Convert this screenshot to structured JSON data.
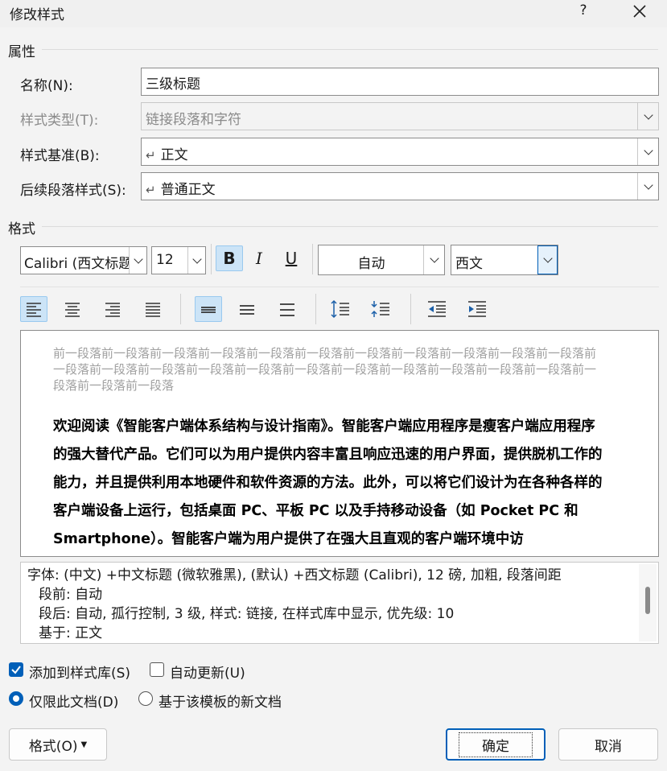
{
  "window": {
    "title": "修改样式",
    "help": "?",
    "close": "✕"
  },
  "properties": {
    "section_label": "属性",
    "name_label": "名称(N):",
    "name_value": "三级标题",
    "type_label": "样式类型(T):",
    "type_value": "链接段落和字符",
    "based_label": "样式基准(B):",
    "based_value": "正文",
    "next_label": "后续段落样式(S):",
    "next_value": "普通正文"
  },
  "format": {
    "section_label": "格式",
    "font": "Calibri (西文标题",
    "size": "12",
    "bold": "B",
    "italic": "I",
    "underline": "U",
    "color": "自动",
    "script": "西文"
  },
  "preview": {
    "previous_paragraph": "前一段落前一段落前一段落前一段落前一段落前一段落前一段落前一段落前一段落前一段落前一段落前一段落前一段落前一段落前一段落前一段落前一段落前一段落前一段落前一段落前一段落前一段落前一段落前一段落前一段落",
    "sample_text": "欢迎阅读《智能客户端体系结构与设计指南》。智能客户端应用程序是瘦客户端应用程序的强大替代产品。它们可以为用户提供内容丰富且响应迅速的用户界面，提供脱机工作的能力，并且提供利用本地硬件和软件资源的方法。此外，可以将它们设计为在各种各样的客户端设备上运行，包括桌面 PC、平板 PC 以及手持移动设备（如 Pocket PC 和 Smartphone）。智能客户端为用户提供了在强大且直观的客户端环境中访"
  },
  "description": {
    "line1": "字体: (中文) +中文标题 (微软雅黑), (默认) +西文标题 (Calibri), 12 磅, 加粗, 段落间距",
    "line2": "段前: 自动",
    "line3": "段后: 自动, 孤行控制, 3 级, 样式: 链接, 在样式库中显示, 优先级: 10",
    "line4": "基于: 正文"
  },
  "options": {
    "add_to_gallery": "添加到样式库(S)",
    "auto_update": "自动更新(U)",
    "this_doc_only": "仅限此文档(D)",
    "new_docs_template": "基于该模板的新文档"
  },
  "buttons": {
    "format": "格式(O)",
    "ok": "确定",
    "cancel": "取消"
  },
  "colors": {
    "accent": "#005fb8",
    "active_tool": "#cce4f7"
  }
}
